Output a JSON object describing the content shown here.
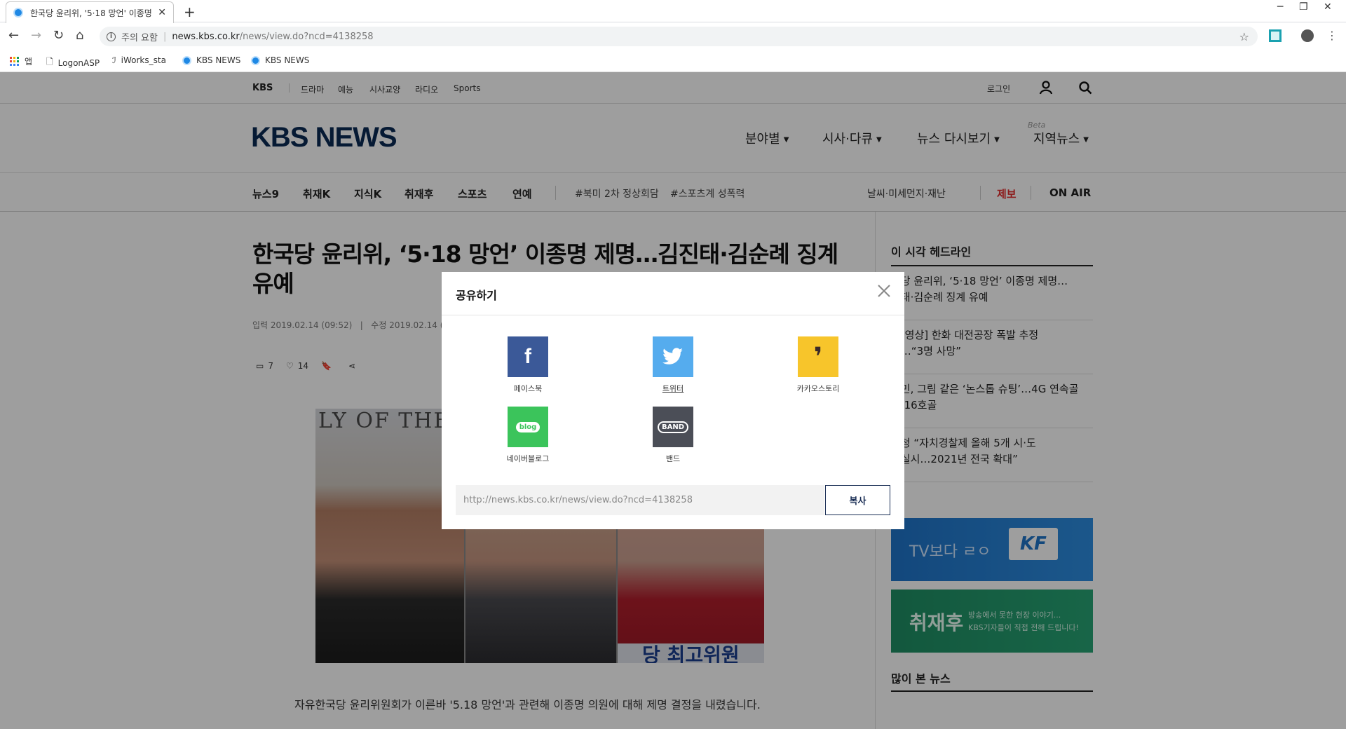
{
  "browser": {
    "tab_title": "한국당 윤리위, '5·18 망언' 이종명",
    "tab_close": "✕",
    "new_tab": "+",
    "omnibox": {
      "security": "주의 요함",
      "separator": "|",
      "url_host": "news.kbs.co.kr",
      "url_path": "/news/view.do?ncd=4138258"
    },
    "bookmarks": [
      {
        "label": "앱",
        "icon": "apps-icon"
      },
      {
        "label": "LogonASP",
        "icon": "page-icon"
      },
      {
        "label": "iWorks_sta",
        "icon": "iworks-icon"
      },
      {
        "label": "KBS NEWS",
        "icon": "kbs-icon"
      },
      {
        "label": "KBS NEWS",
        "icon": "kbs-icon"
      }
    ],
    "window_controls": [
      "─",
      "❐",
      "✕"
    ]
  },
  "gnb": {
    "brand": "KBS",
    "menu": [
      "드라마",
      "예능",
      "시사교양",
      "라디오",
      "Sports"
    ],
    "login": "로그인"
  },
  "header": {
    "logo": "KBS NEWS",
    "menu": [
      "분야별",
      "시사·다큐",
      "뉴스 다시보기",
      "지역뉴스"
    ],
    "beta": "Beta"
  },
  "subnav": {
    "items": [
      "뉴스9",
      "취재K",
      "지식K",
      "취재후",
      "스포츠",
      "연예"
    ],
    "tags": [
      "#북미 2차 정상회담",
      "#스포츠계 성폭력"
    ],
    "weather": "날씨·미세먼지·재난",
    "tip": "제보",
    "onair": "ON AIR"
  },
  "article": {
    "headline": "한국당 윤리위, ‘5·18 망언’ 이종명 제명…김진태·김순례 징계 유예",
    "dates": "입력 2019.02.14 (09:52)   |   수정 2019.02.14 (11:",
    "comments": "7",
    "likes": "14",
    "photo_text_left": "LY OF THE",
    "photo_text_right": "당 최고위원",
    "caption": "자유한국당 윤리위원회가 이른바 '5.18 망언'과 관련해 이종명 의원에 대해 제명 결정을 내렸습니다."
  },
  "sidebar": {
    "title": "이 시각 헤드라인",
    "headlines": [
      "국당 윤리위, ‘5·18 망언’ 이종명 제명…\n진태·김순례 징계 유예",
      "[보영상] 한화 대전공장 폭발 추정\n재…“3명 사망”",
      "흥민, 그림 같은 ‘논스톱 슈팅’…4G 연속골\n즌 16호골",
      "정청 “자치경찰제 올해 5개 시·도\n범실시…2021년 전국 확대”"
    ],
    "banner_tv_text": "TV보다 ㄹㅇ",
    "banner_tv_logo": "KF",
    "banner_green_title": "취재후",
    "banner_green_desc": "방송에서 못한 현장 이야기...\nKBS기자들이 직접 전해 드립니다!",
    "most_viewed": "많이 본 뉴스"
  },
  "share_modal": {
    "title": "공유하기",
    "items": [
      {
        "label": "페이스북",
        "icon": "facebook-icon",
        "glyph": "f"
      },
      {
        "label": "트위터",
        "icon": "twitter-icon"
      },
      {
        "label": "카카오스토리",
        "icon": "kakaostory-icon",
        "glyph": "❜"
      },
      {
        "label": "네이버블로그",
        "icon": "naver-blog-icon",
        "glyph": "blog"
      },
      {
        "label": "밴드",
        "icon": "band-icon",
        "glyph": "BAND"
      }
    ],
    "url": "http://news.kbs.co.kr/news/view.do?ncd=4138258",
    "copy_label": "복사"
  },
  "colors": {
    "kbs_navy": "#0b2a55",
    "facebook": "#3b5998",
    "twitter": "#55acee",
    "kakaostory": "#f7c52b",
    "naver_blog": "#3bc45b",
    "band": "#4b4e57",
    "tip_red": "#e32b2b"
  }
}
